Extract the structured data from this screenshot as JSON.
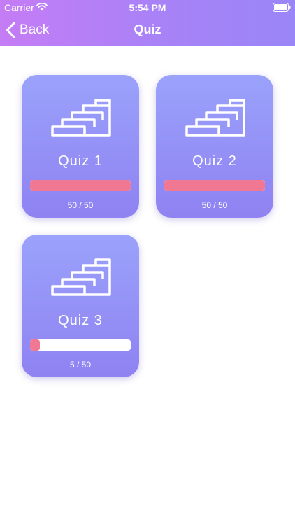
{
  "status_bar": {
    "carrier": "Carrier",
    "time": "5:54 PM",
    "wifi_icon": "wifi-icon",
    "battery_icon": "battery-icon"
  },
  "nav": {
    "back_label": "Back",
    "back_icon": "chevron-left-icon",
    "title": "Quiz"
  },
  "colors": {
    "header_gradient_start": "#c57cf5",
    "header_gradient_end": "#9a86f7",
    "card_gradient_top": "#9aa2fb",
    "card_gradient_bottom": "#8f82f2",
    "progress_fill": "#f07893",
    "progress_track": "#ffffff"
  },
  "quizzes": [
    {
      "title": "Quiz 1",
      "progress_text": "50 / 50",
      "completed": 50,
      "total": 50,
      "icon": "stairs-icon"
    },
    {
      "title": "Quiz 2",
      "progress_text": "50 / 50",
      "completed": 50,
      "total": 50,
      "icon": "stairs-icon"
    },
    {
      "title": "Quiz 3",
      "progress_text": "5 / 50",
      "completed": 5,
      "total": 50,
      "icon": "stairs-icon"
    }
  ]
}
